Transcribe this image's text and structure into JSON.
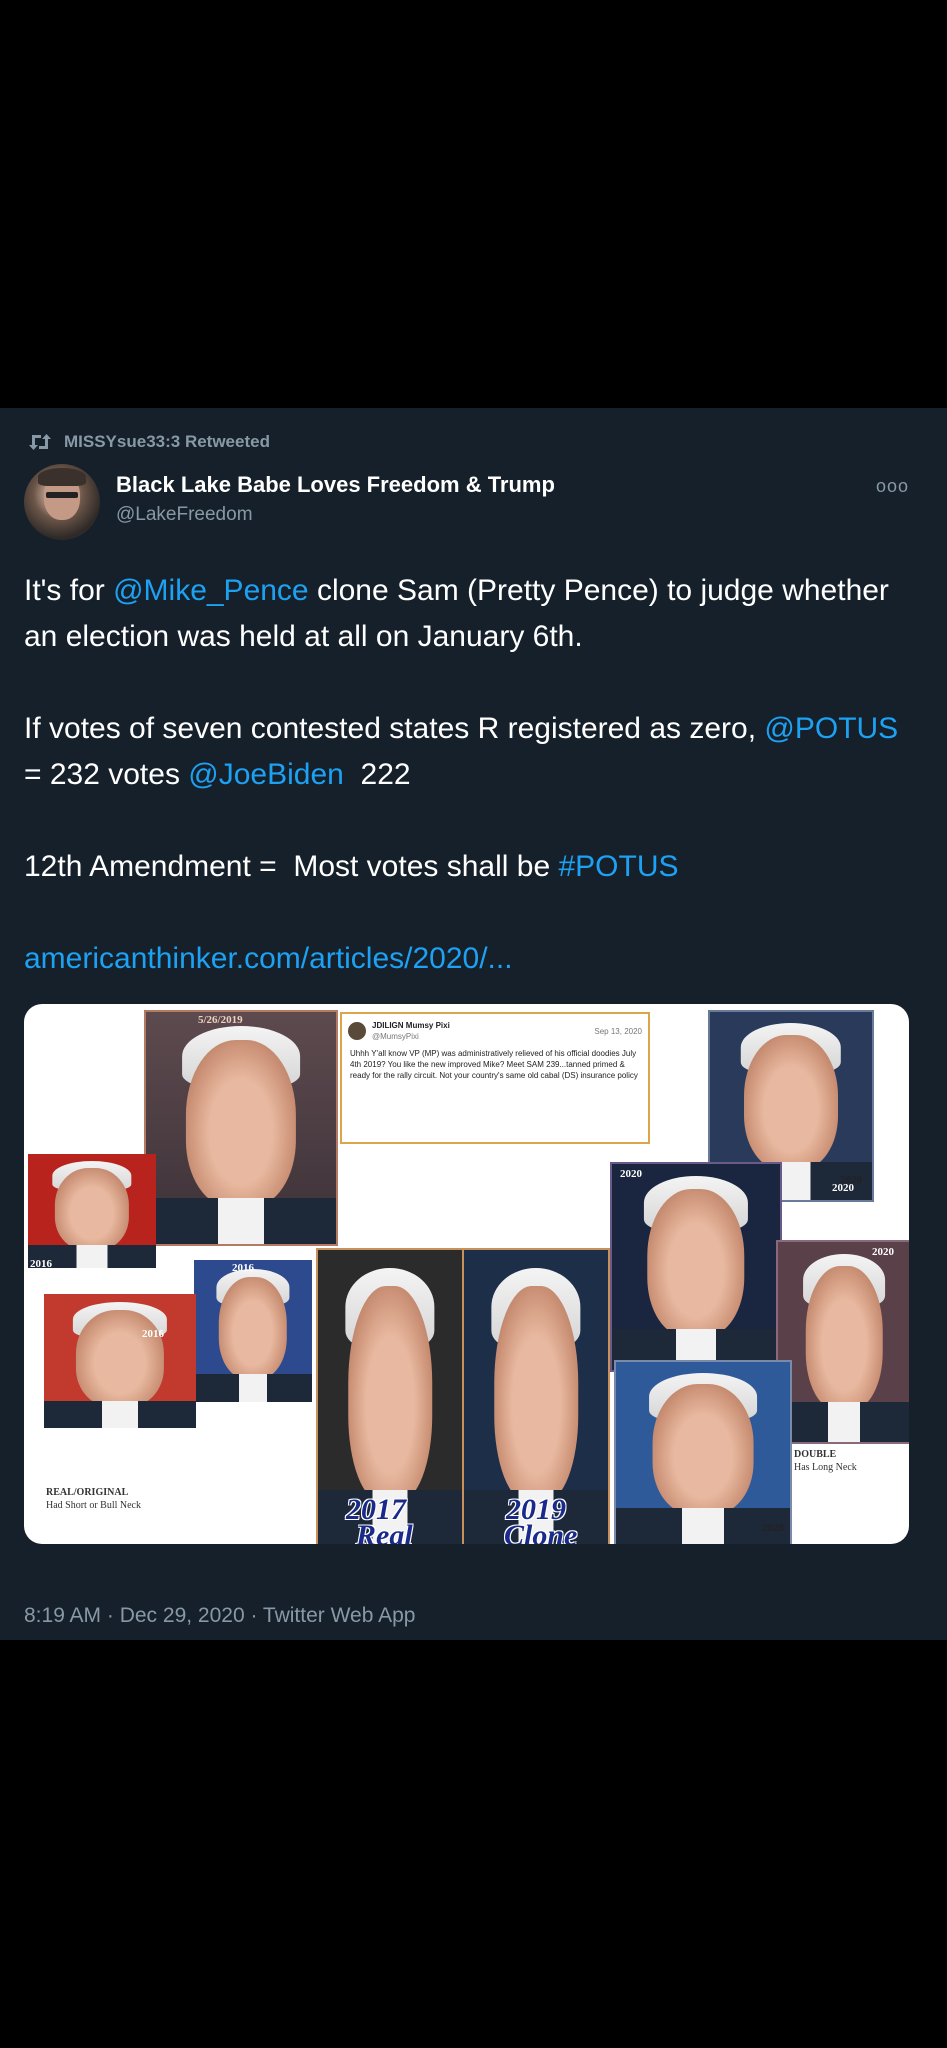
{
  "retweet": {
    "label": "MISSYsue33:3 Retweeted"
  },
  "author": {
    "name": "Black Lake Babe Loves Freedom & Trump",
    "handle": "@LakeFreedom"
  },
  "more_label": "ooo",
  "tweet": {
    "p1_link": "@Mike_Pence",
    "p1_rest": " clone Sam (Pretty Pence) to judge whether an election was held at all on January 6th.",
    "p1_start": "It's for ",
    "p2_start": "If votes of seven contested states R registered as zero, ",
    "p2_potus": "@POTUS",
    "p2_mid": " = 232 votes ",
    "p2_biden": "@JoeBiden",
    "p2_end": "  222",
    "p3_start": "12th Amendment =  Most votes shall be ",
    "p3_tag": "#POTUS",
    "url": "americanthinker.com/articles/2020/..."
  },
  "media": {
    "date_labels": [
      "5/26/2019",
      "2016",
      "2016",
      "2016",
      "2020",
      "2020",
      "2020",
      "2020",
      "2020"
    ],
    "label_2017": "2017",
    "label_real": "Real",
    "label_2019": "2019",
    "label_clone": "Clone",
    "caption_left_title": "REAL/ORIGINAL",
    "caption_left_body": "Had Short or Bull Neck",
    "caption_right_title": "DOUBLE",
    "caption_right_body": "Has Long Neck",
    "embed": {
      "name": "JDILIGN Mumsy Pixi",
      "handle": "@MumsyPixi",
      "date": "Sep 13, 2020",
      "body": "Uhhh Y'all know VP (MP) was administratively relieved of his official doodies July 4th 2019? You like the new improved Mike? Meet SAM 239...tanned primed & ready for the rally circuit. Not your country's same old cabal (DS) insurance policy"
    }
  },
  "footer": "8:19 AM · Dec 29, 2020 · Twitter Web App",
  "colors": {
    "background": "#15202b",
    "link": "#1da1f2",
    "secondary": "#8899a6"
  }
}
